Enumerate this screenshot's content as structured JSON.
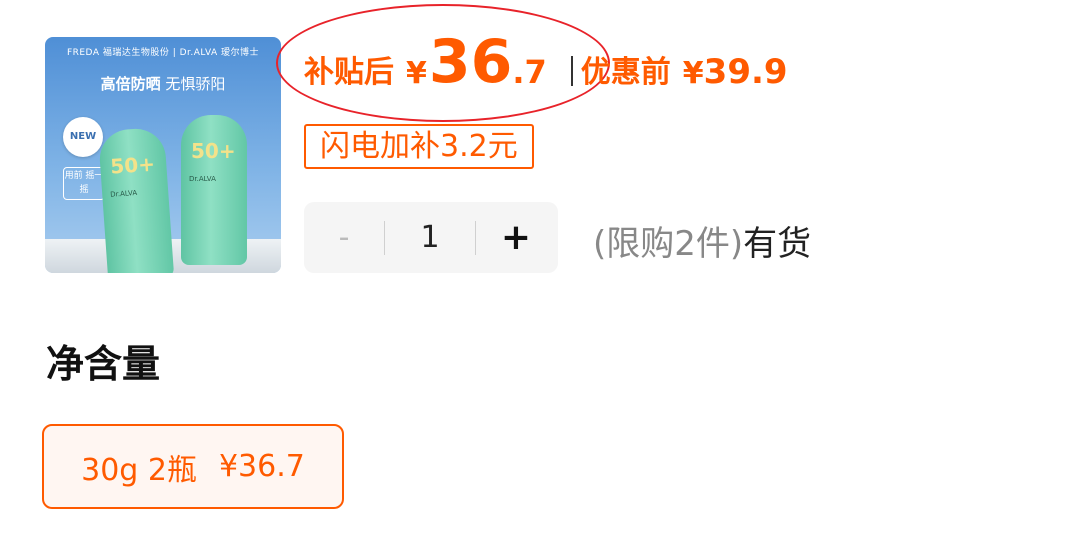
{
  "product": {
    "image": {
      "brand_text": "FREDA 福瑞达生物股份 | Dr.ALVA 瑷尔博士",
      "tagline_bold": "高倍防晒",
      "tagline_light": "无惧骄阳",
      "new_badge": "NEW",
      "use_badge": "用前 摇一摇",
      "bottle_spf": "50+",
      "bottle_label": "Dr.ALVA"
    },
    "price": {
      "subsidy_label": "补贴后",
      "currency": "¥",
      "subsidy_price_int": "36",
      "subsidy_price_dec": ".7",
      "original_label": "优惠前",
      "original_price": "39.9"
    },
    "flash_tag": "闪电加补3.2元",
    "quantity": {
      "minus": "-",
      "value": "1",
      "plus": "+"
    },
    "stock": {
      "limit": "(限购2件)",
      "status": "有货"
    }
  },
  "spec": {
    "section_title": "净含量",
    "options": [
      {
        "label": "30g 2瓶",
        "price": "¥36.7",
        "selected": true
      }
    ]
  },
  "colors": {
    "accent": "#ff5a00",
    "annotation_circle": "#e8232a"
  }
}
